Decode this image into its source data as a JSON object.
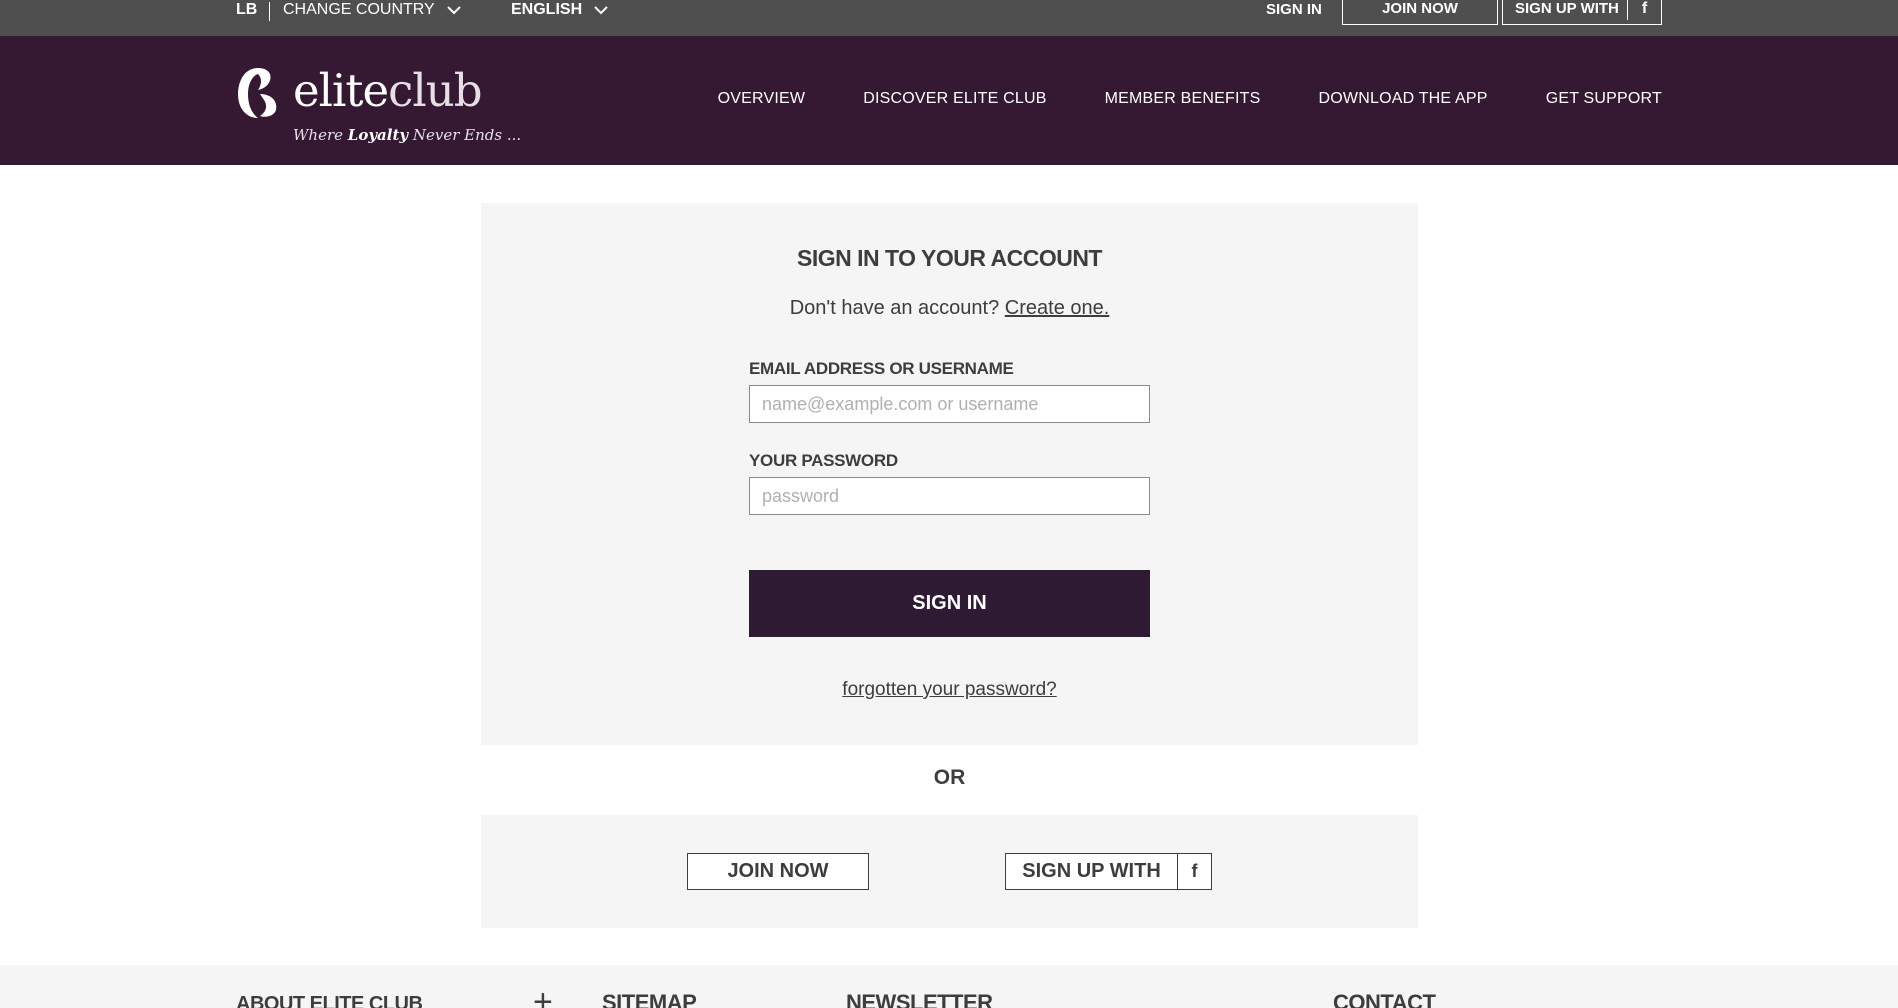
{
  "topbar": {
    "country_code": "LB",
    "change_country": "CHANGE COUNTRY",
    "language": "ENGLISH",
    "sign_in": "SIGN IN",
    "join_now": "JOIN NOW",
    "sign_up_with": "SIGN UP WITH",
    "facebook_glyph": "f"
  },
  "header": {
    "logo": {
      "brand_bold": "elite",
      "brand_light": "club",
      "tagline_pre": "Where ",
      "tagline_bold": "Loyalty",
      "tagline_post": " Never Ends ..."
    },
    "nav": [
      {
        "label": "OVERVIEW"
      },
      {
        "label": "DISCOVER ELITE CLUB"
      },
      {
        "label": "MEMBER BENEFITS"
      },
      {
        "label": "DOWNLOAD THE APP"
      },
      {
        "label": "GET SUPPORT"
      }
    ]
  },
  "signin": {
    "title": "SIGN IN TO YOUR ACCOUNT",
    "no_account_text": "Don't have an account? ",
    "create_link": "Create one.",
    "email_label": "EMAIL ADDRESS OR USERNAME",
    "email_placeholder": "name@example.com or username",
    "email_value": "",
    "password_label": "YOUR PASSWORD",
    "password_placeholder": "password",
    "password_value": "",
    "submit_label": "SIGN IN",
    "forgot_link": "forgotten your password?"
  },
  "or_text": "OR",
  "alt": {
    "join_now": "JOIN NOW",
    "sign_up_with": "SIGN UP WITH",
    "facebook_glyph": "f"
  },
  "footer": {
    "about": "ABOUT ELITE CLUB",
    "expand_glyph": "+",
    "sitemap": "SITEMAP",
    "newsletter": "NEWSLETTER",
    "contact": "CONTACT"
  },
  "colors": {
    "topbar_bg": "#4f4f4f",
    "header_bg": "#351933",
    "button_bg": "#2f1a33",
    "panel_bg": "#f5f5f5",
    "text": "#3d3d3d"
  }
}
